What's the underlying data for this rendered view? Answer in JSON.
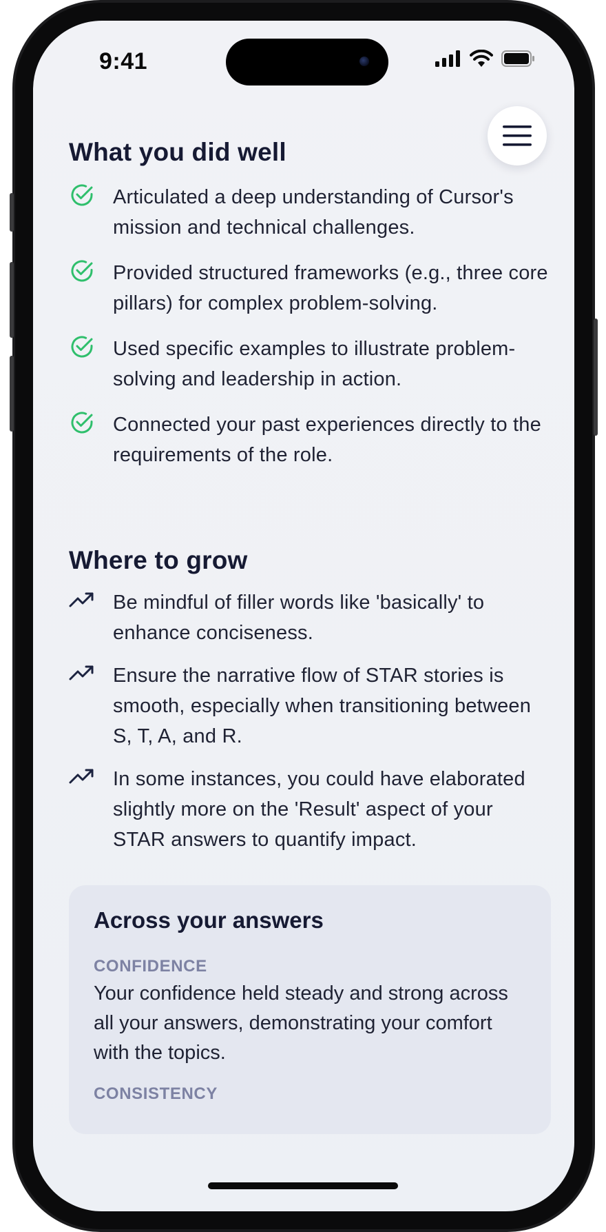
{
  "status_bar": {
    "time": "9:41"
  },
  "header": {
    "menu_icon": "hamburger-menu-icon"
  },
  "did_well": {
    "title": "What you did well",
    "icon": "check-circle-icon",
    "icon_color": "#2fbf6c",
    "items": [
      "Articulated a deep understanding of Cursor's mission and technical challenges.",
      "Provided structured frameworks (e.g., three core pillars) for complex problem-solving.",
      "Used specific examples to illustrate problem-solving and leadership in action.",
      "Connected your past experiences directly to the requirements of the role."
    ]
  },
  "grow": {
    "title": "Where to grow",
    "icon": "trending-up-icon",
    "icon_color": "#1c2340",
    "items": [
      "Be mindful of filler words like 'basically' to enhance conciseness.",
      "Ensure the narrative flow of STAR stories is smooth, especially when transitioning between S, T, A, and R.",
      "In some instances, you could have elaborated slightly more on the 'Result' aspect of your STAR answers to quantify impact."
    ]
  },
  "across": {
    "title": "Across your answers",
    "metrics": [
      {
        "label": "CONFIDENCE",
        "text": "Your confidence held steady and strong across all your answers, demonstrating your comfort with the topics."
      },
      {
        "label": "CONSISTENCY",
        "text": ""
      }
    ]
  },
  "colors": {
    "accent_green": "#2fbf6c",
    "heading": "#161a33",
    "label_muted": "#7d82a3",
    "card_bg": "#e4e7f0"
  }
}
